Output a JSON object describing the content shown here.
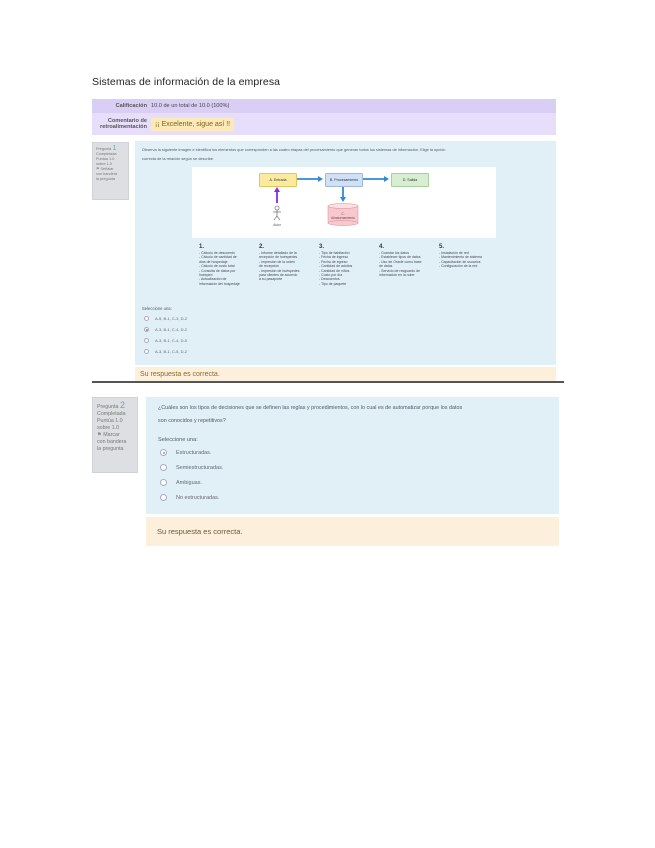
{
  "page": {
    "title": "Sistemas de información de la empresa"
  },
  "summary": {
    "grade_label": "Calificación",
    "grade_value": "10.0 de un total de 10.0 (100%)",
    "feedback_label_1": "Comentario de",
    "feedback_label_2": "retroalimentación",
    "feedback_value": "¡¡ Excelente, sigue así !!"
  },
  "question1": {
    "info": {
      "label": "Pregunta",
      "number": "1",
      "state": "Completada",
      "mark_1": "Puntúa 1.0",
      "mark_2": "sobre 1.0",
      "flag_1": "Señalar",
      "flag_2": "con bandera",
      "flag_3": "la pregunta"
    },
    "prompt_1": "Observa la siguiente imagen e identifica los elementos que corresponden a las cuatro etapas del procesamiento que generan todos los sistemas de información. Elige la opción",
    "prompt_2": "correcta de la relación según se describe.",
    "figure": {
      "stage_a": "A. Entrada",
      "stage_b": "B. Procesamiento",
      "stage_d": "D. Salida",
      "stage_c_1": "C.",
      "stage_c_2": "Almacenamiento",
      "user_label": "Autor",
      "colors": {
        "entrada": "#fbeaa0",
        "procesamiento": "#cfe0f7",
        "salida": "#d7eed0",
        "almacenamiento": "#f7c9cf",
        "arrow_blue": "#2f8ad8",
        "arrow_purple": "#8a2be2"
      }
    },
    "columns": [
      {
        "number": "1.",
        "lines": [
          "- Cálculo de descuento",
          "- Cálculo de cantidad de",
          "días de hospedaje",
          "- Cálculo de costo total",
          "- Consulta de datos por",
          "huésped",
          "- Actualización de",
          "información del hospedaje"
        ]
      },
      {
        "number": "2.",
        "lines": [
          "- Informe detallado de la",
          "recepción de huéspedes",
          "- Impresión de la orden",
          "de recepción",
          "- Impresión de huéspedes",
          "para clientes de acuerdo",
          "a su pasaporte"
        ]
      },
      {
        "number": "3.",
        "lines": [
          "- Tipo de habitación",
          "- Fecha de ingreso",
          "- Fecha de egreso",
          "- Cantidad de adultos",
          "- Cantidad de niños",
          "- Costo por día",
          "- Descuentos",
          "- Tipo de paquete"
        ]
      },
      {
        "number": "4.",
        "lines": [
          "- Guardar los datos",
          "- Establecer tipos de datos",
          "- Uso de Oracle como base",
          "de datos",
          "- Servicio de resguardo de",
          "información en la nube"
        ]
      },
      {
        "number": "5.",
        "lines": [
          "- Instalación de red",
          "- Mantenimiento de sistema",
          "- Capacitación de usuarios",
          "- Configuración de la red"
        ]
      }
    ],
    "select_label": "Seleccione una:",
    "options": [
      {
        "text": "A-5, B-1, C-3, D-2",
        "selected": false
      },
      {
        "text": "A-3, B-1, C-4, D-2",
        "selected": true
      },
      {
        "text": "A-3, B-1, C-4, D-5",
        "selected": false
      },
      {
        "text": "A-3, B-1, C-5, D-2",
        "selected": false
      }
    ],
    "feedback": "Su respuesta es correcta."
  },
  "question2": {
    "info": {
      "label": "Pregunta",
      "number": "2",
      "state": "Completada",
      "mark_1": "Puntúa 1.0",
      "mark_2": "sobre 1.0",
      "flag_1": "Marcar",
      "flag_2": "con bandera",
      "flag_3": "la pregunta"
    },
    "prompt_1": "¿Cuáles son los tipos de decisiones que se definen las reglas y procedimientos, con lo cual es de automatizar porque los datos",
    "prompt_2": "son conocidos y repetitivos?",
    "select_label": "Seleccione una:",
    "options": [
      {
        "text": "Estructuradas.",
        "selected": true
      },
      {
        "text": "Semiestructuradas.",
        "selected": false
      },
      {
        "text": "Ambiguas.",
        "selected": false
      },
      {
        "text": "No estructuradas.",
        "selected": false
      }
    ],
    "feedback": "Su respuesta es correcta."
  }
}
